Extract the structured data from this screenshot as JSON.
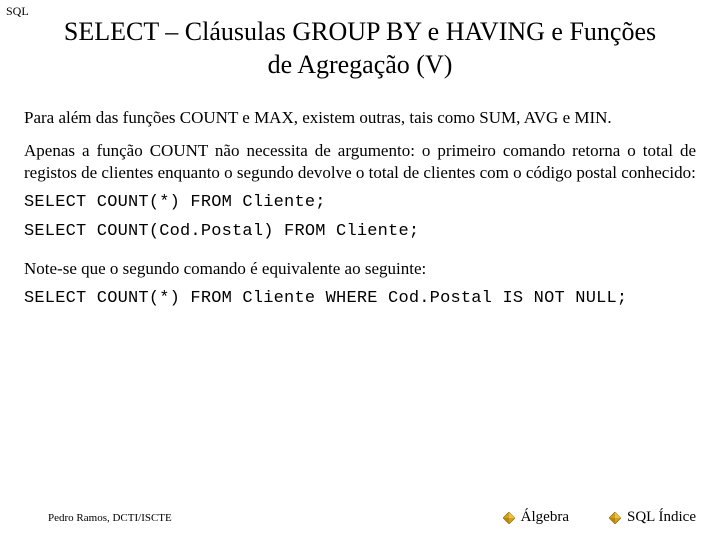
{
  "corner": "SQL",
  "title": "SELECT – Cláusulas GROUP BY e HAVING e Funções de Agregação (V)",
  "para1": "Para além das funções COUNT e MAX, existem outras, tais como SUM, AVG e MIN.",
  "para2": "Apenas a função COUNT não necessita de argumento: o primeiro comando retorna o total de registos de clientes enquanto o segundo devolve o total de clientes com o código postal conhecido:",
  "code1": "SELECT COUNT(*) FROM Cliente;",
  "code2": "SELECT COUNT(Cod.Postal) FROM Cliente;",
  "note": "Note-se que o segundo comando é equivalente ao seguinte:",
  "code3": "SELECT COUNT(*) FROM Cliente WHERE Cod.Postal IS NOT NULL;",
  "footer": {
    "author": "Pedro Ramos, DCTI/ISCTE",
    "link1": "Álgebra",
    "link2": "SQL Índice"
  }
}
